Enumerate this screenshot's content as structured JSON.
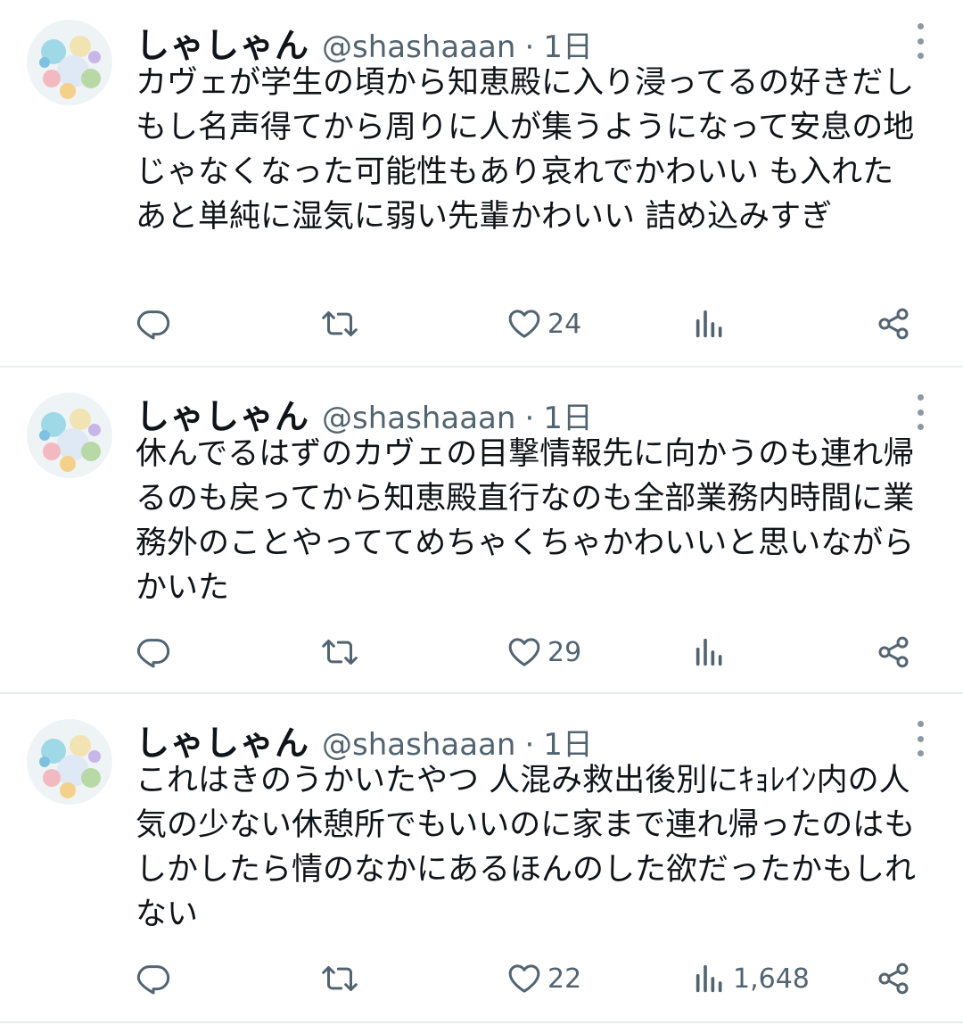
{
  "tweets": [
    {
      "author": "しゃしゃん",
      "handle": "@shashaaan",
      "separator": "·",
      "time": "1日",
      "text": "カヴェが学生の頃から知恵殿に入り浸ってるの好きだしもし名声得てから周りに人が集うようになって安息の地じゃなくなった可能性もあり哀れでかわいい も入れた あと単純に湿気に弱い先輩かわいい 詰め込みすぎ",
      "actions": {
        "reply": "",
        "retweet": "",
        "like": "24",
        "views": "",
        "share": ""
      }
    },
    {
      "author": "しゃしゃん",
      "handle": "@shashaaan",
      "separator": "·",
      "time": "1日",
      "text": "休んでるはずのカヴェの目撃情報先に向かうのも連れ帰るのも戻ってから知恵殿直行なのも全部業務内時間に業務外のことやっててめちゃくちゃかわいいと思いながらかいた",
      "actions": {
        "reply": "",
        "retweet": "",
        "like": "29",
        "views": "",
        "share": ""
      }
    },
    {
      "author": "しゃしゃん",
      "handle": "@shashaaan",
      "separator": "·",
      "time": "1日",
      "text": "これはきのうかいたやつ 人混み救出後別にｷｮﾚｲﾝ内の人気の少ない休憩所でもいいのに家まで連れ帰ったのはもしかしたら情のなかにあるほんのした欲だったかもしれない",
      "actions": {
        "reply": "",
        "retweet": "",
        "like": "22",
        "views": "1,648",
        "share": ""
      }
    }
  ],
  "icons": {
    "reply": "reply-icon",
    "retweet": "retweet-icon",
    "like": "heart-icon",
    "views": "views-icon",
    "share": "share-icon",
    "more": "more-vertical-icon"
  },
  "colors": {
    "text": "#0f1419",
    "secondary": "#536471",
    "divider": "#e6ecf0"
  }
}
